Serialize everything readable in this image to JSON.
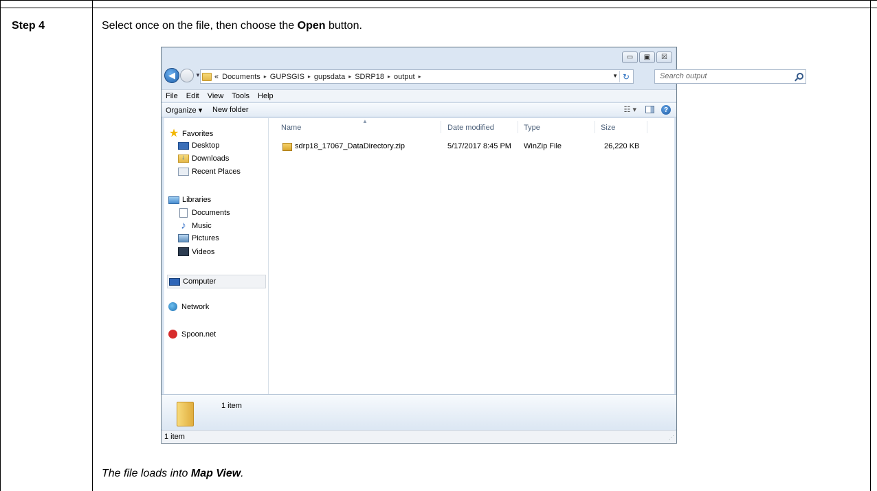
{
  "doc": {
    "step_label": "Step 4",
    "instruction_pre": "Select once on the file, then choose the ",
    "instruction_bold": "Open",
    "instruction_post": " button.",
    "result_pre": "The file loads into ",
    "result_bold": "Map View",
    "result_post": "."
  },
  "window": {
    "controls": {
      "minimize": "▭",
      "maximize": "▣",
      "close": "☒"
    },
    "address": {
      "crumbs": [
        "«",
        "Documents",
        "GUPSGIS",
        "gupsdata",
        "SDRP18",
        "output"
      ],
      "separator": "▸"
    },
    "search": {
      "placeholder": "Search output"
    },
    "menu": [
      "File",
      "Edit",
      "View",
      "Tools",
      "Help"
    ],
    "toolbar": {
      "organize": "Organize ▾",
      "new_folder": "New folder",
      "views": "☷ ▾",
      "help": "?"
    },
    "nav": {
      "favorites": "Favorites",
      "desktop": "Desktop",
      "downloads": "Downloads",
      "recent_places": "Recent Places",
      "libraries": "Libraries",
      "documents": "Documents",
      "music": "Music",
      "pictures": "Pictures",
      "videos": "Videos",
      "computer": "Computer",
      "network": "Network",
      "spoon": "Spoon.net"
    },
    "columns": {
      "name": "Name",
      "date_modified": "Date modified",
      "type": "Type",
      "size": "Size"
    },
    "files": [
      {
        "name": "sdrp18_17067_DataDirectory.zip",
        "date_modified": "5/17/2017 8:45 PM",
        "type": "WinZip File",
        "size": "26,220 KB"
      }
    ],
    "details": {
      "count": "1 item"
    },
    "status": {
      "count": "1 item"
    }
  }
}
